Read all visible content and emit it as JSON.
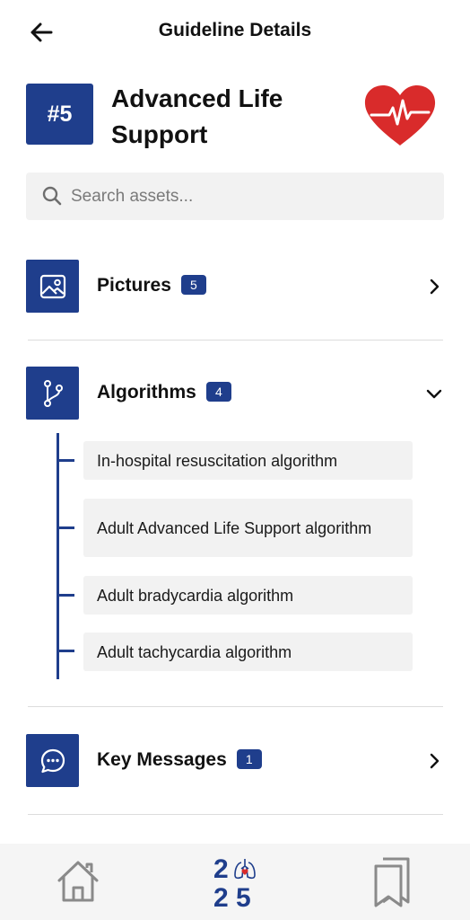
{
  "header": {
    "title": "Guideline Details"
  },
  "guideline": {
    "number": "#5",
    "title": "Advanced Life Support"
  },
  "search": {
    "placeholder": "Search assets...",
    "value": ""
  },
  "sections": {
    "pictures": {
      "label": "Pictures",
      "count": "5",
      "expanded": false
    },
    "algorithms": {
      "label": "Algorithms",
      "count": "4",
      "expanded": true,
      "items": [
        "In-hospital resuscitation algorithm",
        "Adult Advanced Life Support algorithm",
        "Adult bradycardia algorithm",
        "Adult tachycardia algorithm"
      ]
    },
    "key_messages": {
      "label": "Key Messages",
      "count": "1",
      "expanded": false
    }
  },
  "bottom_nav": {
    "logo_digits": [
      "2",
      "2",
      "5"
    ]
  },
  "colors": {
    "primary": "#1f3e8c",
    "heart": "#d92b2b",
    "surface": "#f2f2f2"
  },
  "icons": [
    "arrow-left-icon",
    "heart-pulse-icon",
    "search-icon",
    "image-icon",
    "git-branch-icon",
    "chat-bubble-icon",
    "chevron-right-icon",
    "chevron-down-icon",
    "home-icon",
    "bookmarks-icon",
    "lungs-heart-icon"
  ]
}
